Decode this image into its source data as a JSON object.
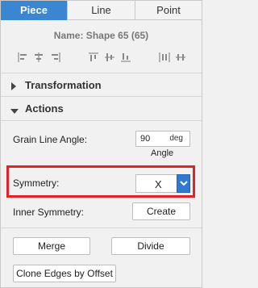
{
  "tabs": [
    {
      "label": "Piece",
      "active": true
    },
    {
      "label": "Line",
      "active": false
    },
    {
      "label": "Point",
      "active": false
    }
  ],
  "shape_name": "Name: Shape 65 (65)",
  "alignment_icons": [
    "align-left-icon",
    "align-center-horizontal-icon",
    "align-right-icon",
    "align-top-icon",
    "align-middle-vertical-icon",
    "align-bottom-icon",
    "distribute-horizontal-icon",
    "distribute-vertical-icon"
  ],
  "sections": {
    "transformation": {
      "label": "Transformation",
      "expanded": false
    },
    "actions": {
      "label": "Actions",
      "expanded": true
    }
  },
  "grain_line": {
    "label": "Grain Line Angle:",
    "value": "90",
    "unit": "deg",
    "caption": "Angle"
  },
  "symmetry": {
    "label": "Symmetry:",
    "value": "X"
  },
  "inner_symmetry": {
    "label": "Inner Symmetry:",
    "button": "Create"
  },
  "buttons": {
    "merge": "Merge",
    "divide": "Divide",
    "clone_edges": "Clone Edges by Offset"
  },
  "colors": {
    "accent": "#3b86d1",
    "highlight": "#e2222b",
    "dropdown": "#2f7ad0"
  }
}
